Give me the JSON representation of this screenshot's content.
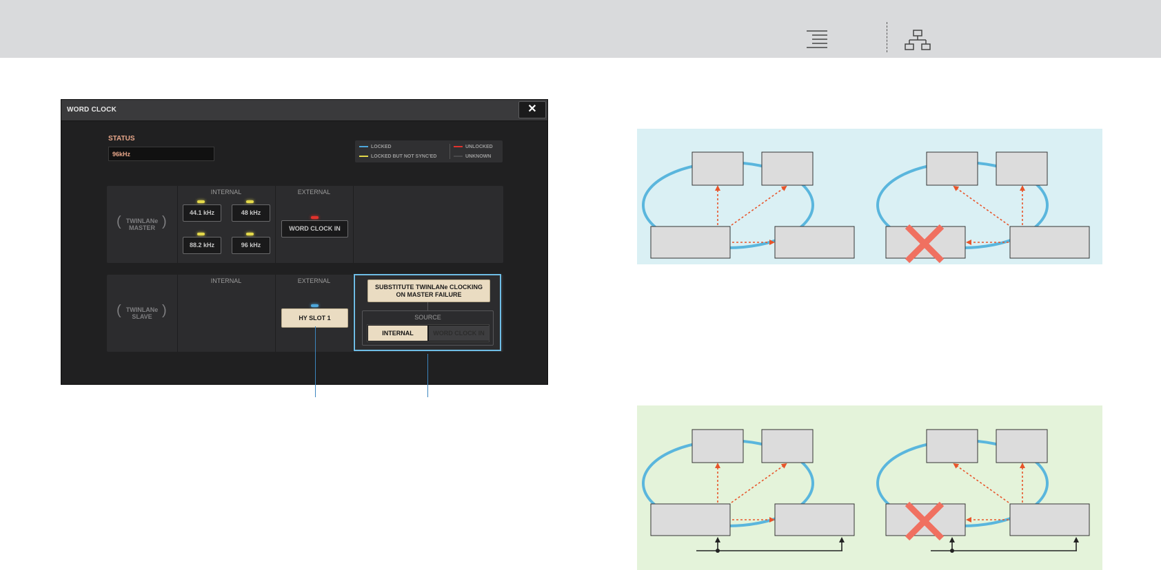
{
  "window": {
    "title": "WORD CLOCK",
    "close_label": "✕"
  },
  "status": {
    "label": "STATUS",
    "value": "96kHz"
  },
  "legend": [
    {
      "label": "LOCKED",
      "color": "#4ea8dc"
    },
    {
      "label": "LOCKED BUT NOT SYNC'ED",
      "color": "#e4d94a"
    },
    {
      "label": "UNLOCKED",
      "color": "#e1322c"
    },
    {
      "label": "UNKNOWN",
      "color": "#4a4a4c"
    }
  ],
  "master": {
    "label_line1": "TWINLANe",
    "label_line2": "MASTER",
    "internal_header": "INTERNAL",
    "external_header": "EXTERNAL",
    "rates": [
      "44.1 kHz",
      "48 kHz",
      "88.2 kHz",
      "96 kHz"
    ],
    "word_clock_in": "WORD CLOCK IN"
  },
  "slave": {
    "label_line1": "TWINLANe",
    "label_line2": "SLAVE",
    "internal_header": "INTERNAL",
    "external_header": "EXTERNAL",
    "hy_slot": "HY SLOT 1"
  },
  "substitute": {
    "button_line1": "SUBSTITUTE TWINLANe CLOCKING",
    "button_line2": "ON MASTER FAILURE",
    "source_label": "SOURCE",
    "options": [
      "INTERNAL",
      "WORD CLOCK IN"
    ],
    "selected": "INTERNAL"
  },
  "colors": {
    "accent": "#6fbde6",
    "selected_button": "#eadcc2",
    "diagram_a_bg": "#daf0f4",
    "diagram_b_bg": "#e4f3da",
    "ring": "#5ab6dd",
    "arrow": "#e8542a",
    "fail_x": "#f07060"
  }
}
